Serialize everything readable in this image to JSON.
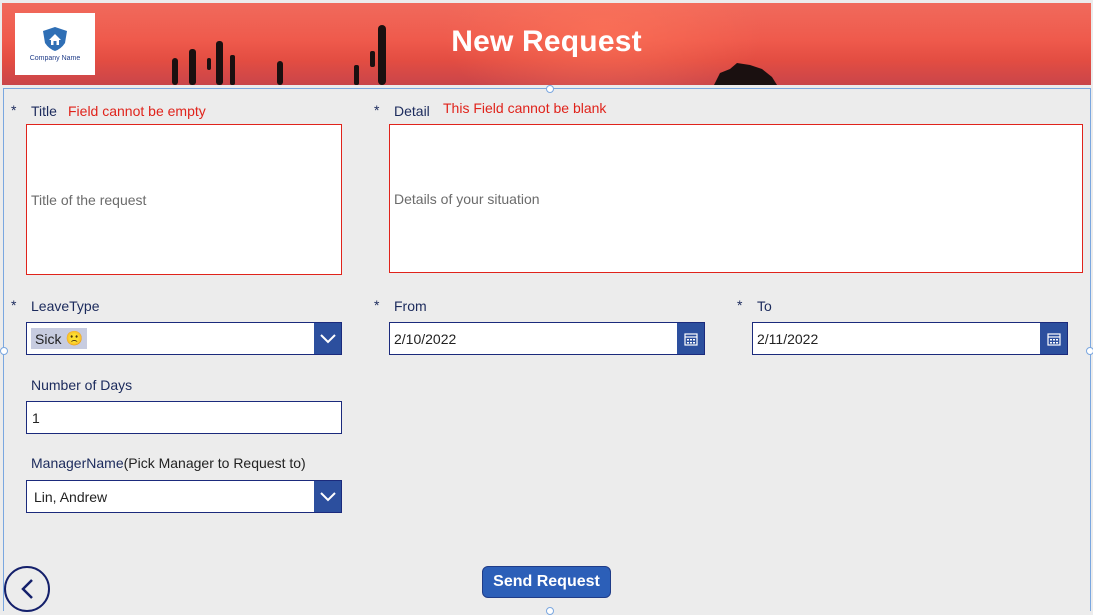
{
  "header": {
    "title": "New Request",
    "logo_text": "Company Name"
  },
  "form": {
    "title_field": {
      "required_mark": "*",
      "label": "Title",
      "error": "Field cannot be empty",
      "placeholder": "Title of the request",
      "value": ""
    },
    "detail_field": {
      "required_mark": "*",
      "label": "Detail",
      "error": "This Field cannot be blank",
      "placeholder": "Details of your situation",
      "value": ""
    },
    "leave_type": {
      "required_mark": "*",
      "label": "LeaveType",
      "selected": "Sick",
      "selected_emoji": "🙁"
    },
    "from": {
      "required_mark": "*",
      "label": "From",
      "value": "2/10/2022"
    },
    "to": {
      "required_mark": "*",
      "label": "To",
      "value": "2/11/2022"
    },
    "num_days": {
      "label": "Number of Days",
      "value": "1"
    },
    "manager": {
      "label": "ManagerName",
      "label_hint": "(Pick Manager to Request to)",
      "selected": "Lin, Andrew"
    }
  },
  "actions": {
    "send_label": "Send Request"
  },
  "colors": {
    "accent": "#2c4f9e",
    "error": "#e0231b",
    "label": "#1b2a5c"
  }
}
